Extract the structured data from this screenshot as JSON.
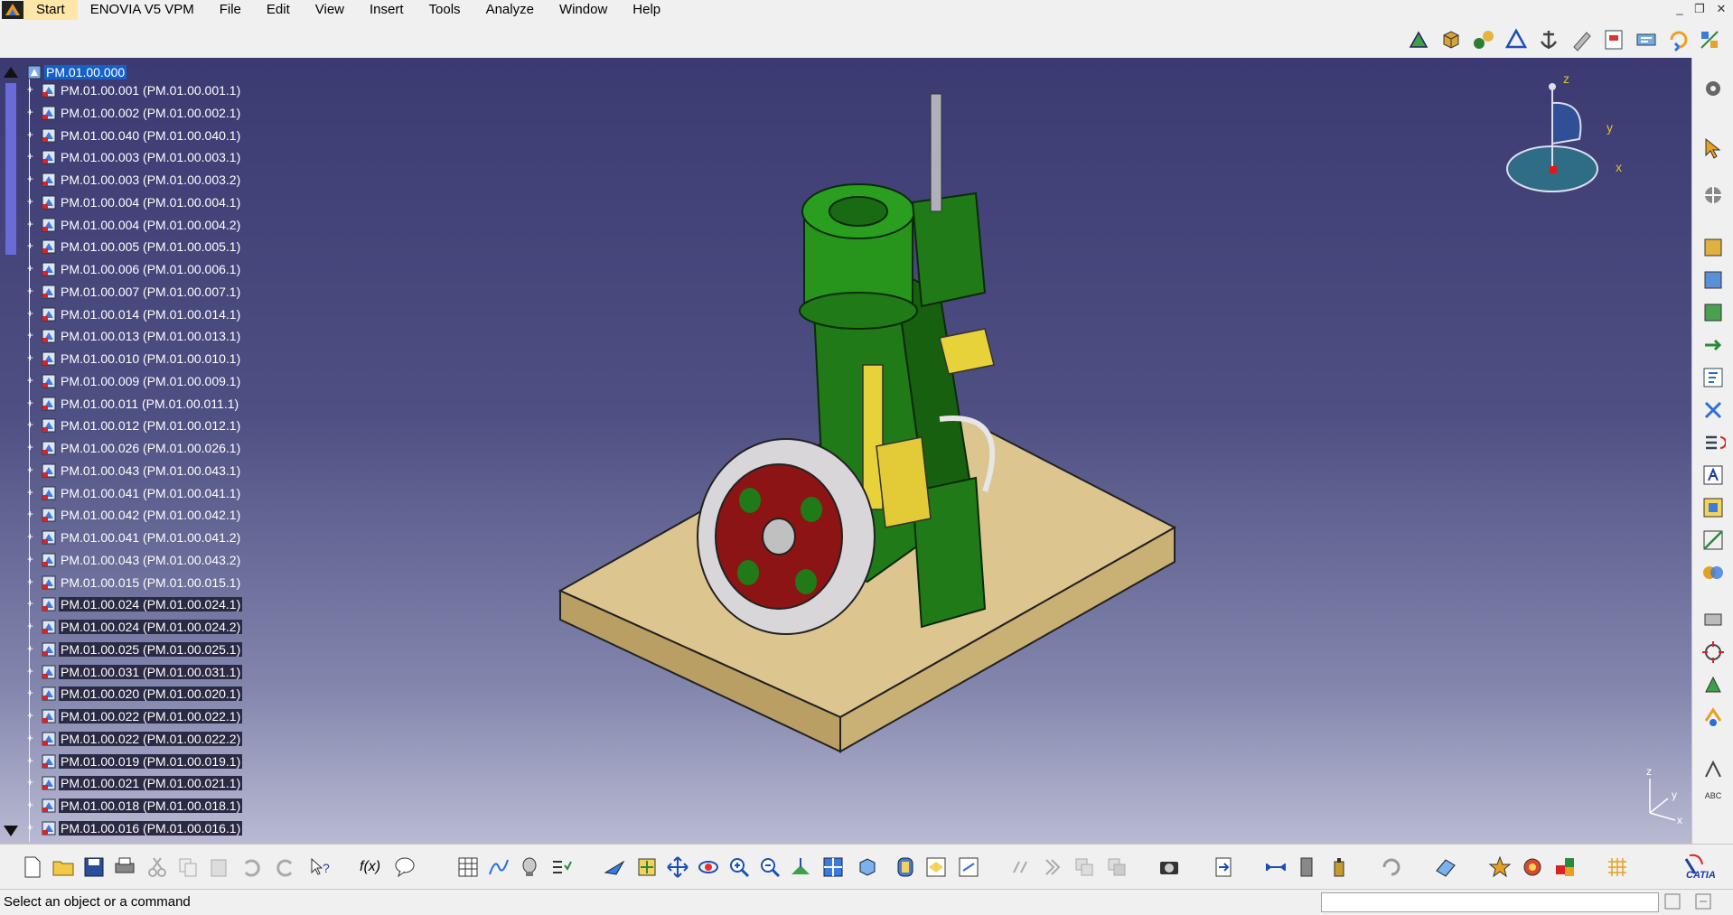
{
  "menu": {
    "items": [
      "Start",
      "ENOVIA V5 VPM",
      "File",
      "Edit",
      "View",
      "Insert",
      "Tools",
      "Analyze",
      "Window",
      "Help"
    ]
  },
  "window": {
    "minimize": "_",
    "restore": "❐",
    "close": "✕"
  },
  "tree": {
    "root": "PM.01.00.000",
    "nodes": [
      "PM.01.00.001 (PM.01.00.001.1)",
      "PM.01.00.002 (PM.01.00.002.1)",
      "PM.01.00.040 (PM.01.00.040.1)",
      "PM.01.00.003 (PM.01.00.003.1)",
      "PM.01.00.003 (PM.01.00.003.2)",
      "PM.01.00.004 (PM.01.00.004.1)",
      "PM.01.00.004 (PM.01.00.004.2)",
      "PM.01.00.005 (PM.01.00.005.1)",
      "PM.01.00.006 (PM.01.00.006.1)",
      "PM.01.00.007 (PM.01.00.007.1)",
      "PM.01.00.014 (PM.01.00.014.1)",
      "PM.01.00.013 (PM.01.00.013.1)",
      "PM.01.00.010 (PM.01.00.010.1)",
      "PM.01.00.009 (PM.01.00.009.1)",
      "PM.01.00.011 (PM.01.00.011.1)",
      "PM.01.00.012 (PM.01.00.012.1)",
      "PM.01.00.026 (PM.01.00.026.1)",
      "PM.01.00.043 (PM.01.00.043.1)",
      "PM.01.00.041 (PM.01.00.041.1)",
      "PM.01.00.042 (PM.01.00.042.1)",
      "PM.01.00.041 (PM.01.00.041.2)",
      "PM.01.00.043 (PM.01.00.043.2)",
      "PM.01.00.015 (PM.01.00.015.1)",
      "PM.01.00.024 (PM.01.00.024.1)",
      "PM.01.00.024 (PM.01.00.024.2)",
      "PM.01.00.025 (PM.01.00.025.1)",
      "PM.01.00.031 (PM.01.00.031.1)",
      "PM.01.00.020 (PM.01.00.020.1)",
      "PM.01.00.022 (PM.01.00.022.1)",
      "PM.01.00.022 (PM.01.00.022.2)",
      "PM.01.00.019 (PM.01.00.019.1)",
      "PM.01.00.021 (PM.01.00.021.1)",
      "PM.01.00.018 (PM.01.00.018.1)",
      "PM.01.00.016 (PM.01.00.016.1)"
    ]
  },
  "compass": {
    "z": "z",
    "y": "y",
    "x": "x"
  },
  "axis_small": {
    "z": "z",
    "y": "y",
    "x": "x"
  },
  "right_toolbar": {
    "abc_label": "ABC"
  },
  "bottom_toolbar": {
    "fx_label": "f(x)",
    "catia_label": "CATIA"
  },
  "status": {
    "message": "Select an object or a command"
  },
  "colors": {
    "viewport_top": "#3b3a72",
    "viewport_bottom": "#b9bad2",
    "engine_green": "#1f7a17",
    "flywheel_red": "#8c1414",
    "base_tan": "#d9c08c",
    "selection": "#1561c8"
  }
}
